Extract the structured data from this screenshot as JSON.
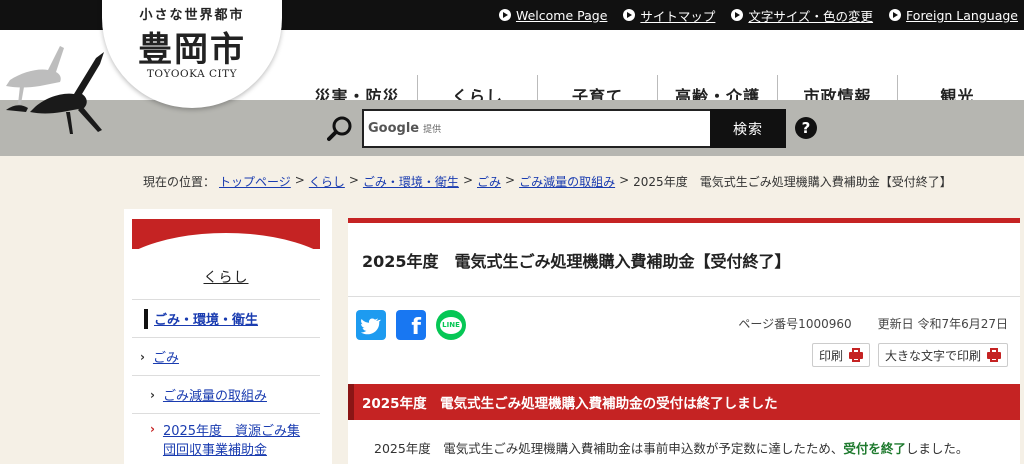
{
  "top_links": [
    {
      "label": "Welcome Page"
    },
    {
      "label": "サイトマップ"
    },
    {
      "label": "文字サイズ・色の変更"
    },
    {
      "label": "Foreign Language"
    }
  ],
  "logo": {
    "tagline": "小さな世界都市",
    "name": "豊岡市",
    "english": "TOYOOKA CITY"
  },
  "global_nav": [
    {
      "label": "災害・防災"
    },
    {
      "label": "くらし"
    },
    {
      "label": "子育て"
    },
    {
      "label": "高齢・介護"
    },
    {
      "label": "市政情報"
    },
    {
      "label": "観光"
    }
  ],
  "search": {
    "google_label": "Google",
    "provided_label": "提供",
    "button_label": "検索",
    "help_label": "?"
  },
  "breadcrumb": {
    "prefix": "現在の位置：",
    "links": [
      "トップページ",
      "くらし",
      "ごみ・環境・衛生",
      "ごみ",
      "ごみ減量の取組み"
    ],
    "separator": ">",
    "current": "2025年度　電気式生ごみ処理機購入費補助金【受付終了】"
  },
  "sidebar": {
    "title": "くらし",
    "category": "ごみ・環境・衛生",
    "level2": "ごみ",
    "level3": "ごみ減量の取組み",
    "current": "2025年度　資源ごみ集団回収事業補助金"
  },
  "main": {
    "title": "2025年度　電気式生ごみ処理機購入費補助金【受付終了】",
    "page_number": "ページ番号1000960",
    "updated": "更新日 令和7年6月27日",
    "print_label": "印刷",
    "print_large_label": "大きな文字で印刷",
    "facebook_glyph": "f",
    "line_label": "LINE",
    "notice": "2025年度　電気式生ごみ処理機購入費補助金の受付は終了しました",
    "body_before": "2025年度　電気式生ごみ処理機購入費補助金は事前申込数が予定数に達したため、",
    "body_emphasis": "受付を終了",
    "body_after": "しました。"
  },
  "colors": {
    "accent_red": "#c52323",
    "link_blue": "#1a3cb0",
    "emphasis_green": "#1e7a2e"
  }
}
